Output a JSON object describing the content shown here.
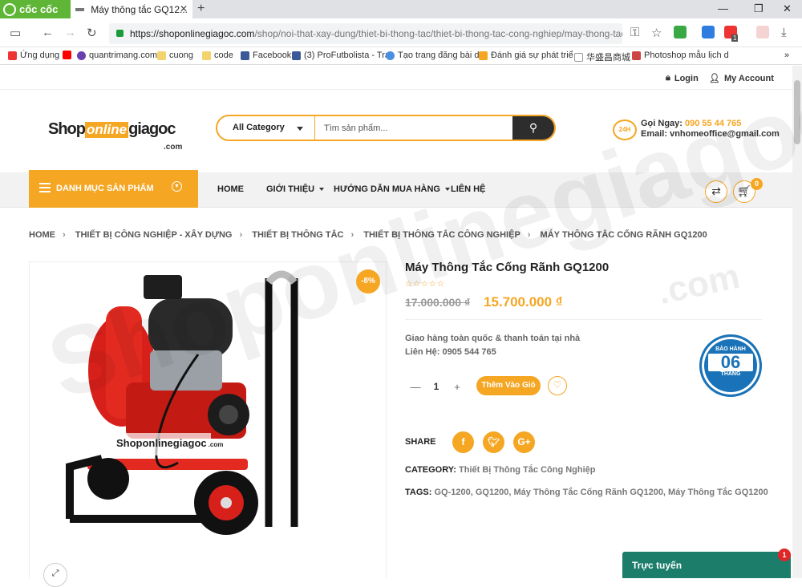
{
  "browser": {
    "brand": "cốc cốc",
    "tab_title": "Máy thông tắc GQ12...",
    "url_host": "https://shoponlinegiagoc.com",
    "url_path": "/shop/noi-that-xay-dung/thiet-bi-thong-tac/thiet-bi-thong-tac-cong-nghiep/may-thong-tac-c...",
    "ext_badge": "1",
    "bookmarks": [
      "Ứng dụng",
      "quantrimang.com",
      "cuong",
      "code",
      "Facebook",
      "(3) ProFutbolista - Tra",
      "Tạo trang đăng bài de",
      "Đánh giá sự phát triể",
      "华盛昌商城",
      "Photoshop mẫu lịch d"
    ],
    "colors": {
      "brand_green": "#5fb636",
      "accent": "#f5a623"
    }
  },
  "top": {
    "login": "Login",
    "account": "My Account"
  },
  "logo": {
    "part1": "Shop",
    "part2": "online",
    "part3": "giagoc",
    "suffix": ".com"
  },
  "search": {
    "category": "All Category",
    "placeholder": "Tìm sản phẩm..."
  },
  "hotline": {
    "icon_text": "24H",
    "call_label": "Gọi Ngay:",
    "phone": "090 55 44 765",
    "email_label": "Email:",
    "email": "vnhomeoffice@gmail.com"
  },
  "nav": {
    "category_menu": "DANH MỤC SẢN PHẨM",
    "items": [
      "HOME",
      "GIỚI THIỆU",
      "HƯỚNG DẪN MUA HÀNG",
      "LIÊN HỆ"
    ],
    "cart_count": "0"
  },
  "breadcrumb": [
    "HOME",
    "THIẾT BỊ CÔNG NGHIỆP - XÂY DỰNG",
    "THIẾT BỊ THÔNG TẮC",
    "THIẾT BỊ THÔNG TẮC CÔNG NGHIỆP",
    "MÁY THÔNG TẮC CỐNG RÃNH GQ1200"
  ],
  "product": {
    "sale_badge": "-8%",
    "title": "Máy Thông Tắc Cống Rãnh GQ1200",
    "stars": "☆☆☆☆☆",
    "price_old": "17.000.000 ₫",
    "price_new": "15.700.000 ₫",
    "desc1": "Giao hàng toàn quốc & thanh toán tại nhà",
    "desc2": "Liên Hệ: 0905 544 765",
    "seal_top": "BẢO HÀNH",
    "seal_num": "06",
    "seal_bottom": "THÁNG",
    "quantity": "1",
    "add_to_cart": "Thêm Vào Giỏ",
    "share_label": "SHARE",
    "category_label": "CATEGORY:",
    "category_value": "Thiết Bị Thông Tắc Công Nghiệp",
    "tags_label": "TAGS:",
    "tags_value": "GQ-1200, GQ1200, Máy Thông Tắc Cống Rãnh GQ1200, Máy Thông Tắc GQ1200",
    "image_logo": "Shoponlinegiagoc",
    "image_logo_suffix": ".com"
  },
  "chat": {
    "label": "Trực tuyến",
    "badge": "1"
  }
}
